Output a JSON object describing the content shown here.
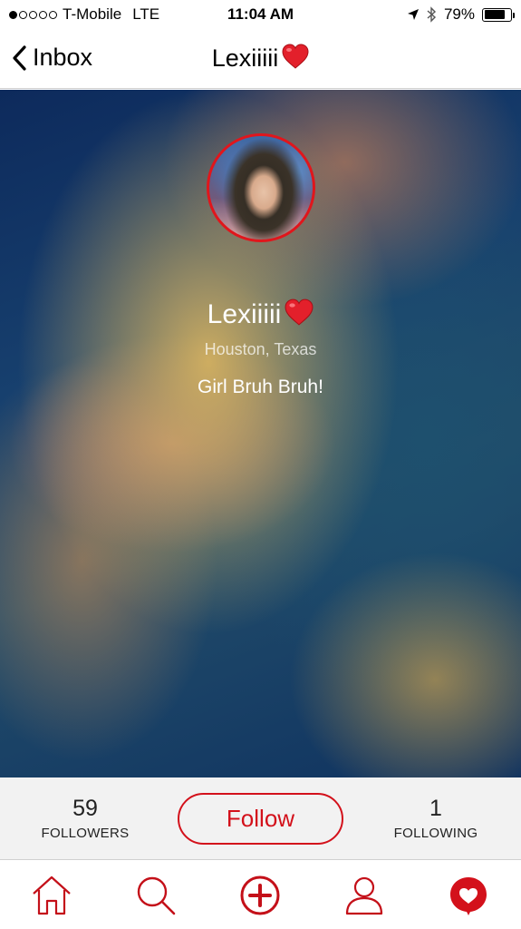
{
  "status_bar": {
    "carrier": "T-Mobile",
    "network": "LTE",
    "time": "11:04 AM",
    "battery": "79%",
    "battery_level": 0.79,
    "signal_bars_filled": 1,
    "signal_bars_total": 5
  },
  "nav": {
    "back_label": "Inbox",
    "title": "Lexiiiii"
  },
  "profile": {
    "name": "Lexiiiii",
    "location": "Houston, Texas",
    "bio": "Girl Bruh Bruh!"
  },
  "stats": {
    "followers_count": "59",
    "followers_label": "FOLLOWERS",
    "follow_button": "Follow",
    "following_count": "1",
    "following_label": "FOLLOWING"
  },
  "tabs": [
    {
      "icon": "home-icon"
    },
    {
      "icon": "search-icon"
    },
    {
      "icon": "add-icon"
    },
    {
      "icon": "profile-icon"
    },
    {
      "icon": "heart-icon"
    }
  ],
  "colors": {
    "accent": "#d3111b",
    "stats_bg": "#f2f2f2"
  }
}
